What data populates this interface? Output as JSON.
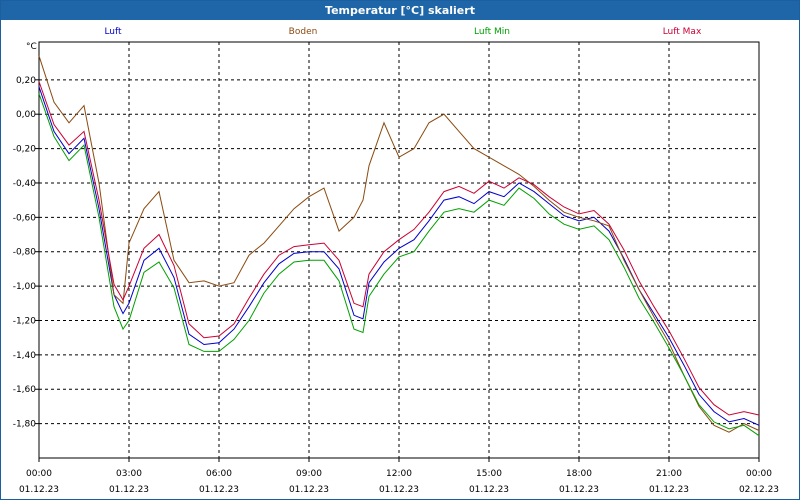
{
  "window": {
    "title": "Temperatur [°C] skaliert"
  },
  "chart_data": {
    "type": "line",
    "title": "Temperatur [°C] skaliert",
    "ylabel": "°C",
    "xlabel": "",
    "ylim": [
      -2.0,
      0.42
    ],
    "xlim": [
      0,
      24
    ],
    "grid": true,
    "legend_position": "top",
    "y_ticks": [
      {
        "value": 0.2,
        "label": "0,20"
      },
      {
        "value": 0.0,
        "label": "0,00"
      },
      {
        "value": -0.2,
        "label": "-0,20"
      },
      {
        "value": -0.4,
        "label": "-0,40"
      },
      {
        "value": -0.6,
        "label": "-0,60"
      },
      {
        "value": -0.8,
        "label": "-0,80"
      },
      {
        "value": -1.0,
        "label": "-1,00"
      },
      {
        "value": -1.2,
        "label": "-1,20"
      },
      {
        "value": -1.4,
        "label": "-1,40"
      },
      {
        "value": -1.6,
        "label": "-1,60"
      },
      {
        "value": -1.8,
        "label": "-1,80"
      }
    ],
    "x_ticks": [
      {
        "value": 0,
        "time": "00:00",
        "date": "01.12.23"
      },
      {
        "value": 3,
        "time": "03:00",
        "date": "01.12.23"
      },
      {
        "value": 6,
        "time": "06:00",
        "date": "01.12.23"
      },
      {
        "value": 9,
        "time": "09:00",
        "date": "01.12.23"
      },
      {
        "value": 12,
        "time": "12:00",
        "date": "01.12.23"
      },
      {
        "value": 15,
        "time": "15:00",
        "date": "01.12.23"
      },
      {
        "value": 18,
        "time": "18:00",
        "date": "01.12.23"
      },
      {
        "value": 21,
        "time": "21:00",
        "date": "01.12.23"
      },
      {
        "value": 24,
        "time": "00:00",
        "date": "02.12.23"
      }
    ],
    "x": [
      0,
      0.5,
      1.0,
      1.5,
      2.0,
      2.5,
      2.8,
      3.0,
      3.5,
      4.0,
      4.5,
      5.0,
      5.5,
      6.0,
      6.5,
      7.0,
      7.5,
      8.0,
      8.5,
      9.0,
      9.5,
      10.0,
      10.5,
      10.8,
      11.0,
      11.5,
      12.0,
      12.5,
      13.0,
      13.5,
      14.0,
      14.5,
      15.0,
      15.5,
      16.0,
      16.5,
      17.0,
      17.5,
      18.0,
      18.5,
      19.0,
      19.5,
      20.0,
      20.5,
      21.0,
      21.5,
      22.0,
      22.5,
      23.0,
      23.5,
      24.0
    ],
    "series": [
      {
        "name": "Luft",
        "color": "#0000cc",
        "values": [
          0.16,
          -0.1,
          -0.23,
          -0.14,
          -0.55,
          -1.05,
          -1.16,
          -1.1,
          -0.85,
          -0.78,
          -0.95,
          -1.28,
          -1.34,
          -1.33,
          -1.25,
          -1.12,
          -0.98,
          -0.87,
          -0.81,
          -0.8,
          -0.8,
          -0.9,
          -1.17,
          -1.19,
          -0.98,
          -0.86,
          -0.78,
          -0.73,
          -0.62,
          -0.5,
          -0.48,
          -0.52,
          -0.45,
          -0.48,
          -0.4,
          -0.45,
          -0.52,
          -0.59,
          -0.62,
          -0.6,
          -0.68,
          -0.84,
          -1.02,
          -1.16,
          -1.3,
          -1.46,
          -1.63,
          -1.73,
          -1.79,
          -1.77,
          -1.81
        ]
      },
      {
        "name": "Boden",
        "color": "#8b4a10",
        "values": [
          0.34,
          0.07,
          -0.05,
          0.05,
          -0.4,
          -1.05,
          -1.1,
          -0.75,
          -0.55,
          -0.45,
          -0.85,
          -0.98,
          -0.97,
          -1.0,
          -0.98,
          -0.82,
          -0.75,
          -0.65,
          -0.55,
          -0.48,
          -0.43,
          -0.68,
          -0.6,
          -0.5,
          -0.3,
          -0.05,
          -0.25,
          -0.2,
          -0.05,
          0.0,
          -0.1,
          -0.2,
          -0.25,
          -0.3,
          -0.35,
          -0.42,
          -0.5,
          -0.57,
          -0.6,
          -0.62,
          -0.65,
          -0.85,
          -1.02,
          -1.18,
          -1.33,
          -1.52,
          -1.7,
          -1.81,
          -1.85,
          -1.8,
          -1.84
        ]
      },
      {
        "name": "Luft Min",
        "color": "#00a000",
        "values": [
          0.12,
          -0.13,
          -0.27,
          -0.18,
          -0.6,
          -1.12,
          -1.25,
          -1.2,
          -0.92,
          -0.86,
          -1.01,
          -1.34,
          -1.38,
          -1.38,
          -1.31,
          -1.2,
          -1.04,
          -0.93,
          -0.86,
          -0.85,
          -0.85,
          -0.97,
          -1.25,
          -1.27,
          -1.06,
          -0.93,
          -0.83,
          -0.8,
          -0.68,
          -0.57,
          -0.55,
          -0.57,
          -0.5,
          -0.53,
          -0.43,
          -0.49,
          -0.58,
          -0.64,
          -0.67,
          -0.65,
          -0.73,
          -0.89,
          -1.07,
          -1.21,
          -1.36,
          -1.52,
          -1.69,
          -1.79,
          -1.83,
          -1.81,
          -1.87
        ]
      },
      {
        "name": "Luft Max",
        "color": "#cc0033",
        "values": [
          0.19,
          -0.06,
          -0.18,
          -0.1,
          -0.5,
          -0.99,
          -1.08,
          -1.0,
          -0.78,
          -0.7,
          -0.88,
          -1.22,
          -1.3,
          -1.29,
          -1.22,
          -1.07,
          -0.93,
          -0.82,
          -0.77,
          -0.76,
          -0.75,
          -0.85,
          -1.1,
          -1.12,
          -0.93,
          -0.8,
          -0.73,
          -0.67,
          -0.57,
          -0.45,
          -0.42,
          -0.46,
          -0.39,
          -0.43,
          -0.37,
          -0.41,
          -0.48,
          -0.54,
          -0.58,
          -0.56,
          -0.64,
          -0.79,
          -0.97,
          -1.12,
          -1.26,
          -1.42,
          -1.59,
          -1.69,
          -1.75,
          -1.73,
          -1.75
        ]
      }
    ]
  }
}
